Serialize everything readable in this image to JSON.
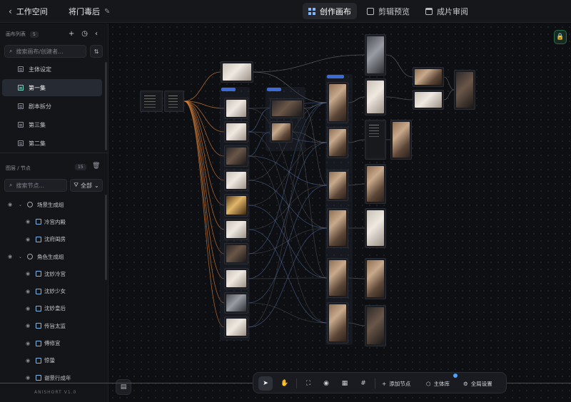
{
  "topbar": {
    "back_label": "工作空间",
    "project_name": "将门毒后",
    "tabs": [
      {
        "label": "创作画布",
        "icon": "grid-icon",
        "active": true
      },
      {
        "label": "剪辑预览",
        "icon": "film-icon",
        "active": false
      },
      {
        "label": "成片审阅",
        "icon": "screen-icon",
        "active": false
      }
    ]
  },
  "sidebar": {
    "canvas_section": {
      "title": "画布列表",
      "count": "5",
      "search_placeholder": "搜索画布/创建者...",
      "items": [
        {
          "label": "主体设定",
          "active": false
        },
        {
          "label": "第一集",
          "active": true
        },
        {
          "label": "剧本拆分",
          "active": false
        },
        {
          "label": "第三集",
          "active": false
        },
        {
          "label": "第二集",
          "active": false
        }
      ]
    },
    "layer_section": {
      "title": "图层 / 节点",
      "count": "15",
      "search_placeholder": "搜索节点...",
      "filter_label": "全部",
      "rows": [
        {
          "label": "场景生成组",
          "type": "group"
        },
        {
          "label": "冷宫内殿",
          "type": "image"
        },
        {
          "label": "沈府闺房",
          "type": "image"
        },
        {
          "label": "角色生成组",
          "type": "group"
        },
        {
          "label": "沈妙冷宫",
          "type": "image"
        },
        {
          "label": "沈妙少女",
          "type": "image"
        },
        {
          "label": "沈妙皇后",
          "type": "image"
        },
        {
          "label": "传旨太监",
          "type": "image"
        },
        {
          "label": "傅修宜",
          "type": "image"
        },
        {
          "label": "惊蛰",
          "type": "image"
        },
        {
          "label": "谢景行成年",
          "type": "image"
        }
      ]
    },
    "version": "ANISHORT V1.0"
  },
  "toolbar": {
    "add_node_label": "添加节点",
    "library_label": "主体库",
    "settings_label": "全局设置"
  },
  "colors": {
    "accent_blue": "#3d6bd6",
    "lock_green": "#4ad18c",
    "wire_orange": "#d9823b",
    "wire_blue": "#6a8fd8",
    "wire_gray": "#8a8f99"
  }
}
